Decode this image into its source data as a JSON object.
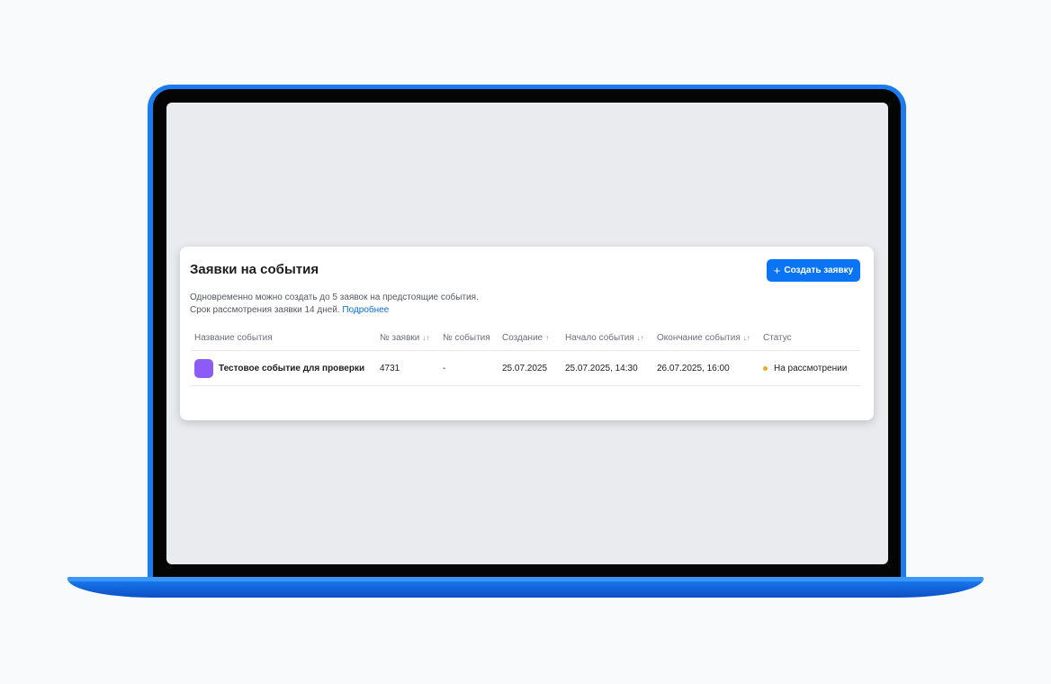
{
  "page": {
    "title": "Заявки на события",
    "create_button": {
      "icon": "plus-icon",
      "label": "Создать заявку"
    },
    "description": {
      "line1": "Одновременно можно создать до 5 заявок на предстоящие события.",
      "line2": "Срок рассмотрения заявки 14 дней.",
      "link": "Подробнее"
    }
  },
  "table": {
    "columns": [
      {
        "label": "Название события",
        "sort": ""
      },
      {
        "label": "№ заявки",
        "sort": "↓↑"
      },
      {
        "label": "№ события",
        "sort": ""
      },
      {
        "label": "Создание",
        "sort": "↑"
      },
      {
        "label": "Начало события",
        "sort": "↓↑"
      },
      {
        "label": "Окончание события",
        "sort": "↓↑"
      },
      {
        "label": "Статус",
        "sort": ""
      }
    ],
    "rows": [
      {
        "name": "Тестовое событие для проверки",
        "request_no": "4731",
        "event_no": "-",
        "created": "25.07.2025",
        "start": "25.07.2025, 14:30",
        "end": "26.07.2025, 16:00",
        "status": "На рассмотрении"
      }
    ]
  },
  "colors": {
    "accent": "#0a74f5",
    "avatar": "#8b5cf6",
    "status_pending": "#f5a623",
    "laptop": "#1a7cf0"
  }
}
